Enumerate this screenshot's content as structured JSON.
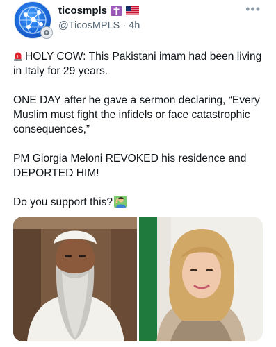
{
  "author": {
    "display_name": "ticosmpls",
    "handle": "@TicosMPLS",
    "separator": "·",
    "time": "4h",
    "badges": [
      "cross-flag-icon",
      "us-flag-icon"
    ]
  },
  "tweet": {
    "paragraphs": [
      "HOLY COW: This Pakistani imam had been living in Italy for 29 years.",
      "ONE DAY after he gave a sermon declaring, “Every Muslim must fight the infidels or face catastrophic consequences,”",
      "PM Giorgia Meloni REVOKED his residence and DEPORTED HIM!",
      "Do you support this?"
    ]
  },
  "media": {
    "count": 2,
    "items": [
      "imam-photo",
      "meloni-photo"
    ]
  },
  "colors": {
    "text": "#0f1419",
    "secondary": "#536471",
    "accent_badge": "#9b59b6"
  }
}
